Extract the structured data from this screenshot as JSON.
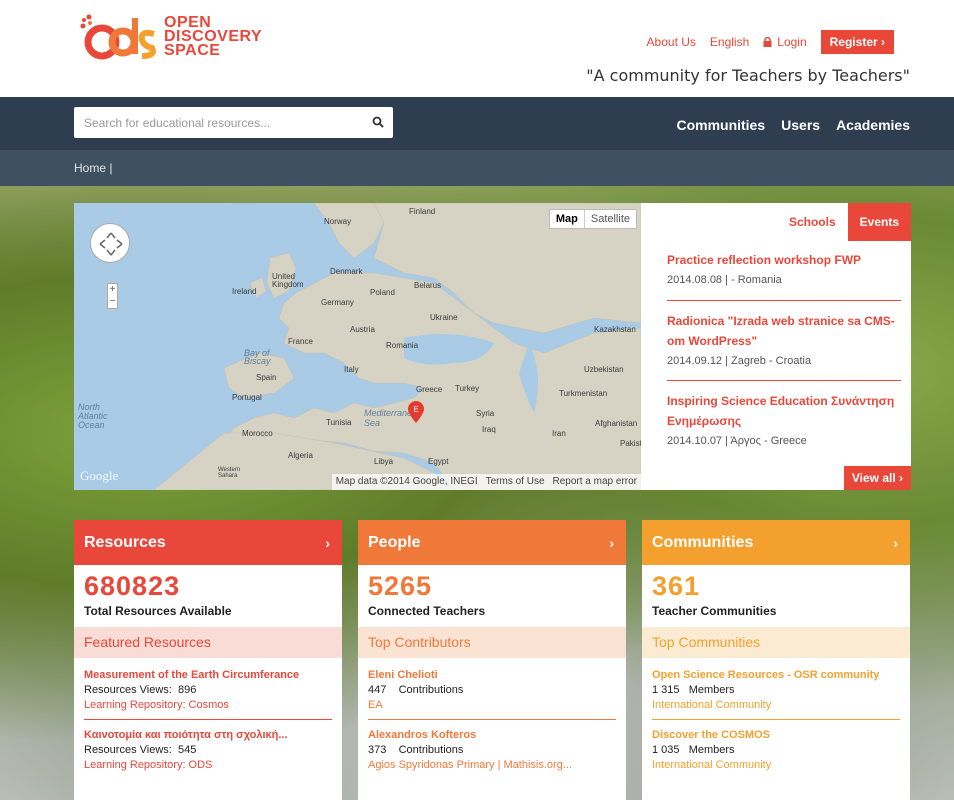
{
  "header": {
    "logo_text": [
      "OPEN",
      "DISCOVERY",
      "SPACE"
    ],
    "links": {
      "about": "About Us",
      "language": "English",
      "login": "Login",
      "register": "Register ›"
    },
    "tagline": "\"A community for Teachers by Teachers\""
  },
  "nav": {
    "search_placeholder": "Search for educational resources...",
    "items": [
      "Communities",
      "Users",
      "Academies"
    ]
  },
  "breadcrumb": "Home |",
  "map": {
    "toggle": [
      "Map",
      "Satellite"
    ],
    "marker_label": "E",
    "google": "Google",
    "footer": [
      "Map data ©2014 Google, INEGI",
      "Terms of Use",
      "Report a map error"
    ],
    "labels": {
      "finland": "Finland",
      "norway": "Norway",
      "denmark": "Denmark",
      "uk": "United Kingdom",
      "ireland": "Ireland",
      "belarus": "Belarus",
      "poland": "Poland",
      "germany": "Germany",
      "ukraine": "Ukraine",
      "kazakhstan": "Kazakhstan",
      "austria": "Austria",
      "france": "France",
      "romania": "Romania",
      "biscay": "Bay of Biscay",
      "italy": "Italy",
      "uzbekistan": "Uzbekistan",
      "spain": "Spain",
      "portugal": "Portugal",
      "greece": "Greece",
      "turkey": "Turkey",
      "turkmenistan": "Turkmenistan",
      "atlantic": "North Atlantic Ocean",
      "tunisia": "Tunisia",
      "med": "Mediterranean Sea",
      "syria": "Syria",
      "afghanistan": "Afghanistan",
      "iraq": "Iraq",
      "iran": "Iran",
      "pakistan": "Pakist",
      "morocco": "Morocco",
      "algeria": "Algeria",
      "libya": "Libya",
      "egypt": "Egypt",
      "wsahara": "Western Sahara"
    }
  },
  "events_panel": {
    "tabs": [
      "Schools",
      "Events"
    ],
    "events": [
      {
        "title": "Practice reflection workshop FWP",
        "meta": "2014.08.08 | - Romania"
      },
      {
        "title": "Radionica \"Izrada web stranice sa CMS-om WordPress\"",
        "meta": "2014.09.12 | Zagreb - Croatia"
      },
      {
        "title": "Inspiring Science Education Συνάντηση Ενημέρωσης",
        "meta": "2014.10.07 | Άργος - Greece"
      }
    ],
    "view_all": "View all ›"
  },
  "cards": {
    "resources": {
      "title": "Resources",
      "chevron": "›",
      "count": "680823",
      "sub": "Total Resources Available",
      "section": "Featured Resources",
      "items": [
        {
          "title": "Measurement of the Earth Circumferance",
          "meta_label": "Resources Views:",
          "meta_value": "896",
          "source": "Learning Repository:  Cosmos"
        },
        {
          "title": "Καινοτομία και ποιότητα στη σχολική...",
          "meta_label": "Resources Views:",
          "meta_value": "545",
          "source": "Learning Repository:  ODS"
        }
      ]
    },
    "people": {
      "title": "People",
      "chevron": "›",
      "count": "5265",
      "sub": "Connected Teachers",
      "section": "Top Contributors",
      "items": [
        {
          "title": "Eleni Chelioti",
          "meta_label": "447",
          "meta_value": "Contributions",
          "source": "EA"
        },
        {
          "title": "Alexandros Kofteros",
          "meta_label": "373",
          "meta_value": "Contributions",
          "source": "Agios Spyridonas Primary | Mathisis.org..."
        }
      ]
    },
    "communities": {
      "title": "Communities",
      "chevron": "›",
      "count": "361",
      "sub": "Teacher Communities",
      "section": "Top Communities",
      "items": [
        {
          "title": "Open Science Resources - OSR community",
          "meta_label": "1 315",
          "meta_value": "Members",
          "source": "International Community"
        },
        {
          "title": "Discover the COSMOS",
          "meta_label": "1 035",
          "meta_value": "Members",
          "source": "International Community"
        }
      ]
    }
  },
  "colors": {
    "red": "#e8473a",
    "orange": "#f0793a",
    "amber": "#f4a02e",
    "nav": "#2e3d4f",
    "breadcrumb": "#3f5063"
  },
  "icons": [
    "logo-icon",
    "lock-icon",
    "search-icon",
    "pan-icon",
    "map-marker-icon"
  ]
}
